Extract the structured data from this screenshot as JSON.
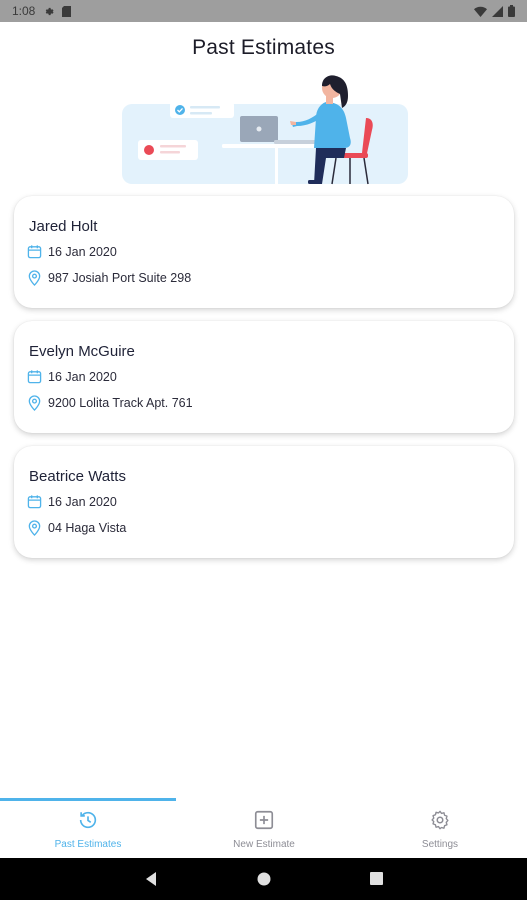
{
  "status_bar": {
    "time": "1:08",
    "icons": [
      "settings-icon",
      "sd-card-icon",
      "wifi-icon",
      "signal-icon",
      "battery-icon"
    ]
  },
  "page": {
    "title": "Past Estimates"
  },
  "illustration": {
    "name": "woman-at-laptop-illustration"
  },
  "estimates": [
    {
      "name": "Jared Holt",
      "date": "16 Jan 2020",
      "address": "987 Josiah Port Suite 298"
    },
    {
      "name": "Evelyn McGuire",
      "date": "16 Jan 2020",
      "address": "9200 Lolita Track Apt. 761"
    },
    {
      "name": "Beatrice Watts",
      "date": "16 Jan 2020",
      "address": "04 Haga Vista"
    }
  ],
  "bottom_nav": {
    "items": [
      {
        "label": "Past Estimates",
        "icon": "history-icon",
        "active": true
      },
      {
        "label": "New Estimate",
        "icon": "add-box-icon",
        "active": false
      },
      {
        "label": "Settings",
        "icon": "gear-icon",
        "active": false
      }
    ]
  },
  "colors": {
    "accent": "#4fb3ea",
    "text_primary": "#1f2237",
    "text_secondary": "#8d8d95",
    "status_bar": "#9e9e9e",
    "illustration_bg": "#e3f2fc"
  }
}
